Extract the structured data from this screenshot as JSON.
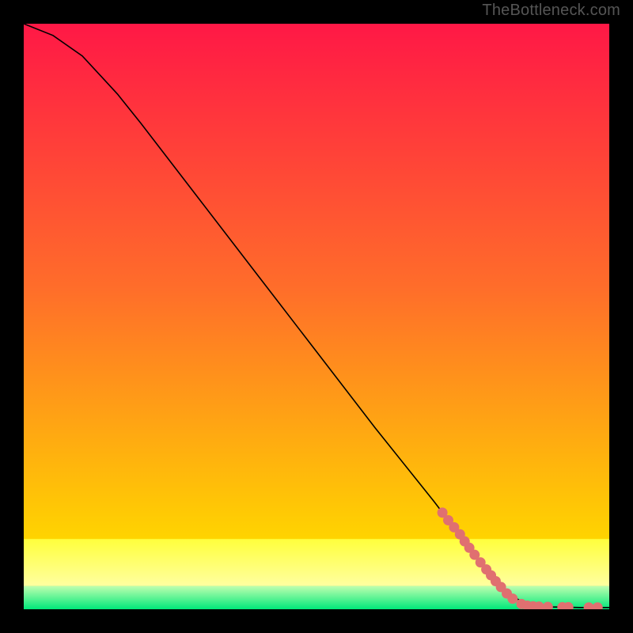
{
  "watermark": "TheBottleneck.com",
  "colors": {
    "top_gradient": "#ff1846",
    "mid_gradient_1": "#ff6d2a",
    "mid_gradient_2": "#ffd400",
    "yellow_band_top": "#ffff3c",
    "yellow_band_bottom": "#ffffa0",
    "green_band_top": "#c0ffb0",
    "green_band_bottom": "#00e87a",
    "curve": "#000000",
    "marker_fill": "#e07070",
    "marker_stroke": "#b04848",
    "background": "#000000"
  },
  "chart_data": {
    "type": "line",
    "title": "",
    "xlabel": "",
    "ylabel": "",
    "xlim": [
      0,
      100
    ],
    "ylim": [
      0,
      100
    ],
    "series": [
      {
        "name": "curve",
        "points": [
          {
            "x": 0,
            "y": 100
          },
          {
            "x": 5,
            "y": 98
          },
          {
            "x": 10,
            "y": 94.5
          },
          {
            "x": 16,
            "y": 88
          },
          {
            "x": 20,
            "y": 83
          },
          {
            "x": 30,
            "y": 70
          },
          {
            "x": 40,
            "y": 57
          },
          {
            "x": 50,
            "y": 44
          },
          {
            "x": 60,
            "y": 31
          },
          {
            "x": 70,
            "y": 18.5
          },
          {
            "x": 78,
            "y": 8
          },
          {
            "x": 83,
            "y": 2.5
          },
          {
            "x": 86,
            "y": 0.8
          },
          {
            "x": 90,
            "y": 0.4
          },
          {
            "x": 95,
            "y": 0.3
          },
          {
            "x": 100,
            "y": 0.3
          }
        ]
      }
    ],
    "markers": [
      {
        "x": 71.5,
        "y": 16.5
      },
      {
        "x": 72.5,
        "y": 15.2
      },
      {
        "x": 73.5,
        "y": 14.0
      },
      {
        "x": 74.5,
        "y": 12.8
      },
      {
        "x": 75.3,
        "y": 11.6
      },
      {
        "x": 76.1,
        "y": 10.5
      },
      {
        "x": 77.0,
        "y": 9.3
      },
      {
        "x": 78.0,
        "y": 8.0
      },
      {
        "x": 79.0,
        "y": 6.8
      },
      {
        "x": 79.8,
        "y": 5.8
      },
      {
        "x": 80.6,
        "y": 4.8
      },
      {
        "x": 81.5,
        "y": 3.8
      },
      {
        "x": 82.5,
        "y": 2.7
      },
      {
        "x": 83.5,
        "y": 1.8
      },
      {
        "x": 85.0,
        "y": 0.9
      },
      {
        "x": 86.0,
        "y": 0.6
      },
      {
        "x": 87.0,
        "y": 0.5
      },
      {
        "x": 88.0,
        "y": 0.45
      },
      {
        "x": 89.5,
        "y": 0.4
      },
      {
        "x": 92.0,
        "y": 0.35
      },
      {
        "x": 93.0,
        "y": 0.35
      },
      {
        "x": 96.5,
        "y": 0.3
      },
      {
        "x": 98.0,
        "y": 0.3
      }
    ],
    "gradient_bands": [
      {
        "from_y": 100,
        "to_y": 12,
        "kind": "smooth",
        "colors": [
          "top_gradient",
          "mid_gradient_1",
          "mid_gradient_2"
        ]
      },
      {
        "from_y": 12,
        "to_y": 4,
        "kind": "band",
        "colors": [
          "yellow_band_top",
          "yellow_band_bottom"
        ]
      },
      {
        "from_y": 4,
        "to_y": 0,
        "kind": "band",
        "colors": [
          "green_band_top",
          "green_band_bottom"
        ]
      }
    ]
  }
}
